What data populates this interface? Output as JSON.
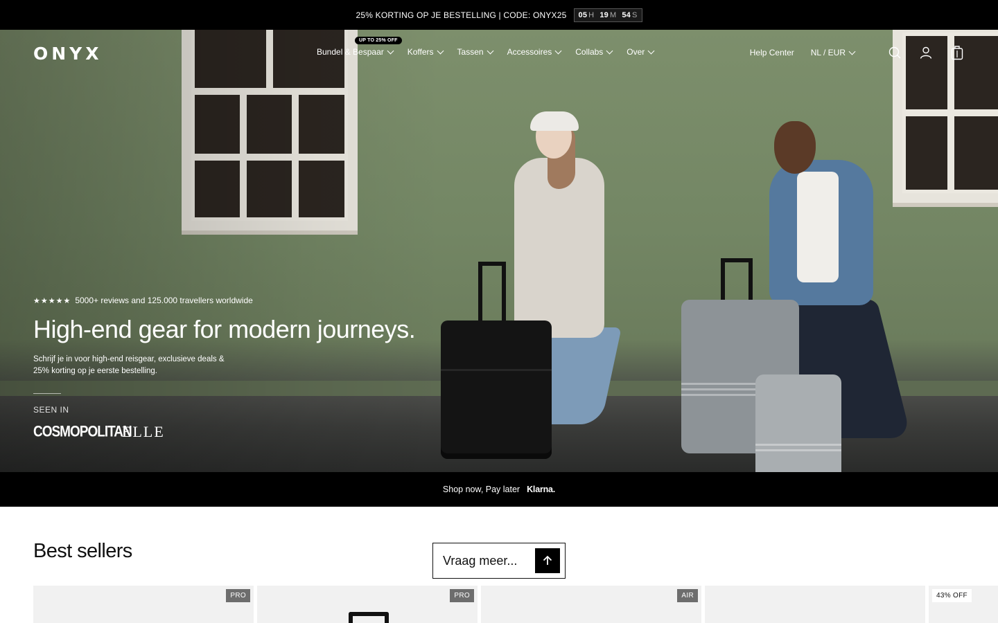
{
  "announcement": {
    "text": "25% KORTING OP JE BESTELLING | CODE: ONYX25",
    "countdown": {
      "hours": "05",
      "hours_unit": "H",
      "minutes": "19",
      "minutes_unit": "M",
      "seconds": "54",
      "seconds_unit": "S"
    }
  },
  "header": {
    "logo": "ONYX",
    "nav": [
      {
        "label": "Bundel & Bespaar",
        "badge": "UP TO 25% OFF"
      },
      {
        "label": "Koffers"
      },
      {
        "label": "Tassen"
      },
      {
        "label": "Accessoires"
      },
      {
        "label": "Collabs"
      },
      {
        "label": "Over"
      }
    ],
    "help_center": "Help Center",
    "locale": "NL / EUR",
    "icons": [
      "search-icon",
      "account-icon",
      "bag-icon"
    ]
  },
  "hero": {
    "stars": "★★★★★",
    "rating_text": "5000+ reviews and 125.000 travellers worldwide",
    "title": "High-end gear for modern journeys.",
    "subtitle": "Schrijf je in voor high-end reisgear, exclusieve deals & 25% korting op je eerste bestelling.",
    "seen_in": "SEEN IN",
    "press": [
      "COSMOPOLITAN",
      "ELLE"
    ]
  },
  "klarna": {
    "text": "Shop now, Pay later",
    "logo": "Klarna."
  },
  "best_sellers": {
    "title": "Best sellers",
    "ask_label": "Vraag meer...",
    "products": [
      {
        "tag": "PRO"
      },
      {
        "tag": "PRO"
      },
      {
        "tag": "AIR"
      },
      {
        "tag": ""
      },
      {
        "tag": "43% OFF"
      }
    ]
  },
  "colors": {
    "announcement_bg": "#000000",
    "hero_wall": "#738664",
    "tag_bg": "#6d6d6d"
  }
}
